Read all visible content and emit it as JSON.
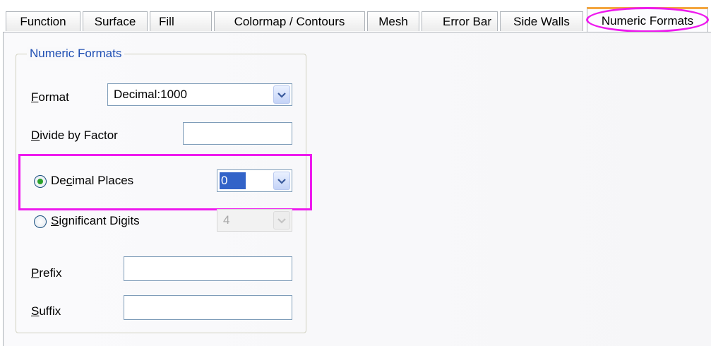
{
  "tabs": [
    {
      "label": "Function"
    },
    {
      "label": "Surface"
    },
    {
      "label": "Fill"
    },
    {
      "label": "Colormap / Contours"
    },
    {
      "label": "Mesh"
    },
    {
      "label": "Error Bar"
    },
    {
      "label": "Side Walls"
    },
    {
      "label": "Numeric Formats"
    }
  ],
  "active_tab": "Numeric Formats",
  "group": {
    "title": "Numeric Formats"
  },
  "format": {
    "label_key": "F",
    "label_rest": "ormat",
    "value": "Decimal:1000"
  },
  "divide": {
    "label_key": "D",
    "label_rest": "ivide by Factor",
    "value": ""
  },
  "decimal_places": {
    "label_pre": "De",
    "label_key": "c",
    "label_rest": "imal Places",
    "value": "0",
    "selected": true
  },
  "significant_digits": {
    "label_pre": "",
    "label_key": "S",
    "label_rest": "ignificant Digits",
    "value": "4",
    "selected": false
  },
  "prefix": {
    "label_key": "P",
    "label_rest": "refix",
    "value": ""
  },
  "suffix": {
    "label_key": "S",
    "label_rest": "uffix",
    "value": ""
  },
  "colors": {
    "highlight": "#ee1aee",
    "group_title": "#1f4fb3",
    "selection": "#3263c8"
  }
}
